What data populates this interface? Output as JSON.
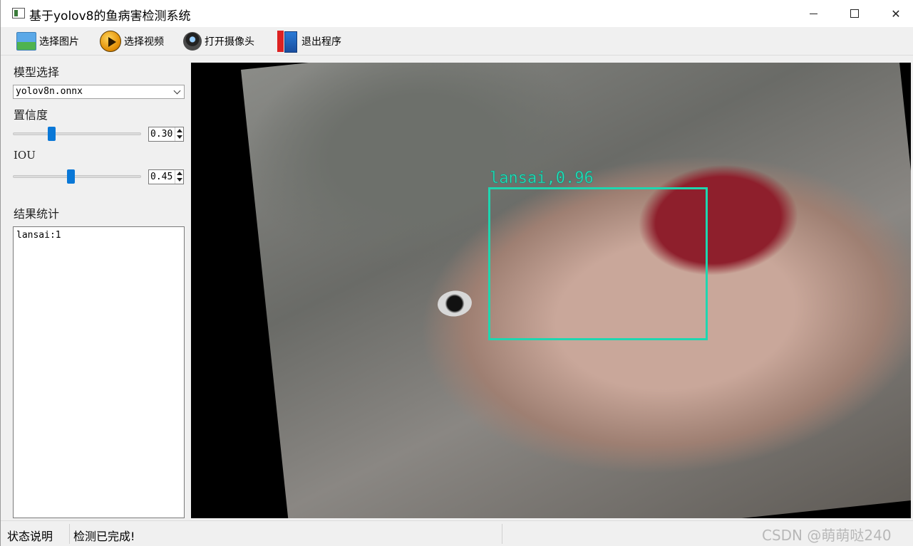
{
  "window": {
    "title": "基于yolov8的鱼病害检测系统",
    "controls": {
      "minimize": "minimize",
      "maximize": "maximize",
      "close": "✕"
    }
  },
  "toolbar": {
    "open_image": "选择图片",
    "open_video": "选择视频",
    "open_camera": "打开摄像头",
    "exit": "退出程序",
    "icons": [
      "image-icon",
      "play-icon",
      "camera-icon",
      "exit-icon"
    ]
  },
  "sidebar": {
    "model_label": "模型选择",
    "model_selected": "yolov8n.onnx",
    "confidence_label": "置信度",
    "confidence_value": "0.30",
    "confidence_level": 0.3,
    "iou_label": "IOU",
    "iou_value": "0.45",
    "iou_level": 0.45,
    "result_label": "结果统计",
    "result_text": "lansai:1"
  },
  "viewer": {
    "detection_label": "lansai,0.96"
  },
  "status": {
    "label": "状态说明",
    "message": "检测已完成!",
    "watermark": "CSDN @萌萌哒240"
  },
  "colors": {
    "slider_handle": "#0a78d7",
    "detection_box": "#1ed6b0"
  }
}
